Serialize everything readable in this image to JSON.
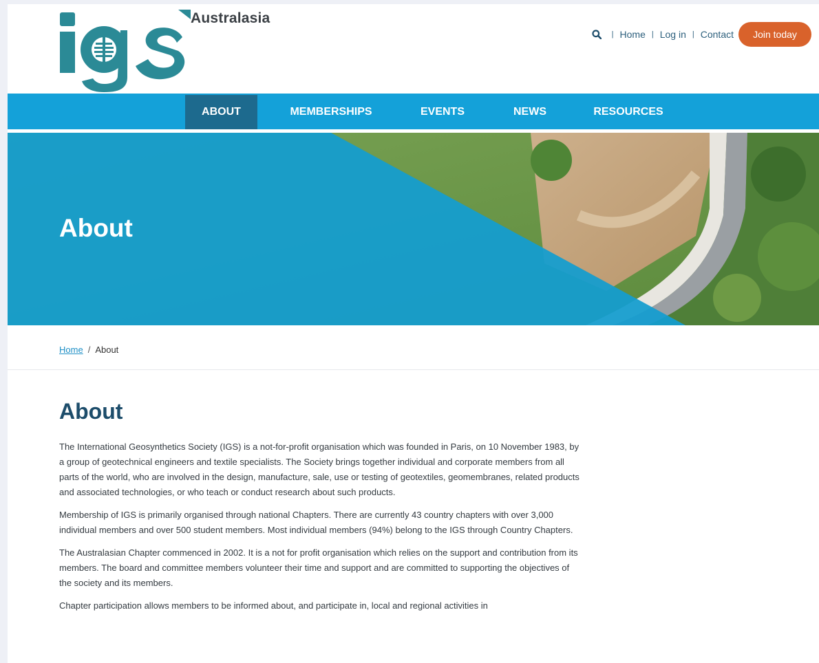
{
  "header": {
    "logo_text": "igs",
    "logo_sub": "Australasia",
    "util_links": [
      "Home",
      "Log in",
      "Contact"
    ],
    "join_label": "Join today"
  },
  "nav": {
    "items": [
      "ABOUT",
      "MEMBERSHIPS",
      "EVENTS",
      "NEWS",
      "RESOURCES"
    ],
    "active": "ABOUT"
  },
  "hero": {
    "title": "About"
  },
  "breadcrumb": {
    "home": "Home",
    "separator": "/",
    "current": "About"
  },
  "content": {
    "heading": "About",
    "paragraphs": [
      "The International Geosynthetics Society (IGS) is a not-for-profit organisation which was founded in Paris, on 10 November 1983, by a group of geotechnical engineers and textile specialists. The Society brings together individual and corporate members from all parts of the world, who are involved in the design, manufacture, sale, use or testing of geotextiles, geomembranes, related products and associated technologies, or who teach or conduct research about such products.",
      "Membership of IGS is primarily organised through national Chapters. There are currently 43 country chapters with over 3,000 individual members and over 500 student members. Most individual members (94%) belong to the IGS through Country Chapters.",
      "The Australasian Chapter commenced in 2002. It is a not for profit organisation which relies on the support and contribution from its members. The board and committee members volunteer their time and support and are committed to supporting the objectives of the society and its members.",
      "Chapter participation allows members to be informed about, and participate in, local and regional activities in"
    ]
  },
  "colors": {
    "brand_teal": "#2b8a96",
    "nav_blue": "#14a1d9",
    "nav_active": "#1d6a8e",
    "join_orange": "#d9622b",
    "heading_navy": "#1d4d6b"
  },
  "icons": {
    "search": "search-icon",
    "logo_mark": "globe-icon"
  }
}
